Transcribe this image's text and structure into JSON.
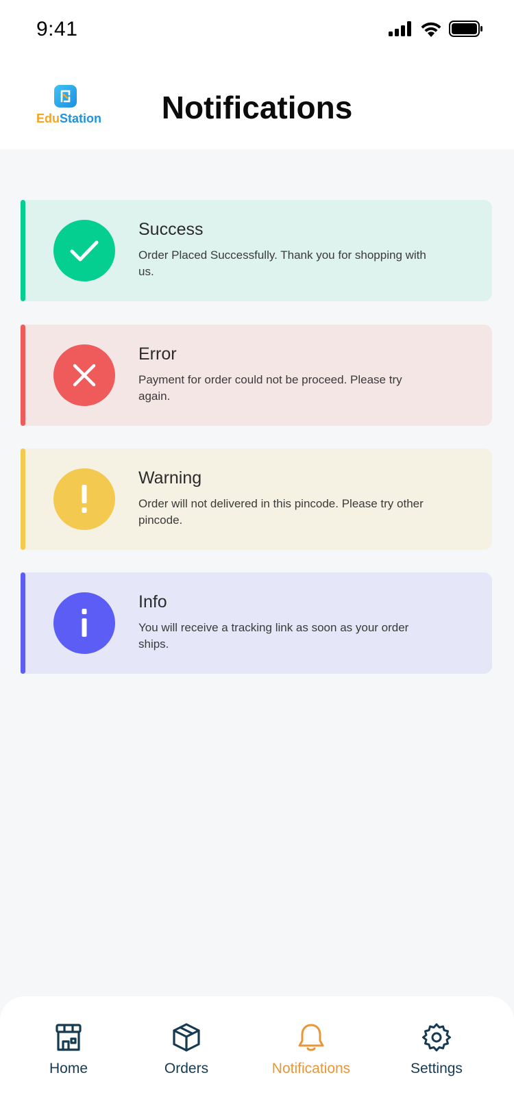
{
  "status_bar": {
    "time": "9:41",
    "icons": [
      "cellular-signal-icon",
      "wifi-icon",
      "battery-icon"
    ]
  },
  "header": {
    "logo": {
      "part1": "Edu",
      "part2": "Station"
    },
    "title": "Notifications"
  },
  "notifications": [
    {
      "type": "success",
      "icon": "checkmark-icon",
      "title": "Success",
      "message": "Order Placed Successfully. Thank you for shopping with us.",
      "accent_color": "#05CE91",
      "background_color": "#DEF2EE"
    },
    {
      "type": "error",
      "icon": "close-icon",
      "title": "Error",
      "message": "Payment for order could not be proceed. Please try again.",
      "accent_color": "#EF5A5A",
      "background_color": "#F5E6E6"
    },
    {
      "type": "warning",
      "icon": "exclamation-icon",
      "title": "Warning",
      "message": "Order will not delivered in this pincode. Please try other pincode.",
      "accent_color": "#F4C94F",
      "background_color": "#F5F1E3"
    },
    {
      "type": "info",
      "icon": "info-icon",
      "title": "Info",
      "message": "You will receive a tracking link as soon as your order ships.",
      "accent_color": "#5B5DF5",
      "background_color": "#E5E6F7"
    }
  ],
  "bottom_nav": {
    "items": [
      {
        "label": "Home",
        "icon": "store-icon",
        "active": false
      },
      {
        "label": "Orders",
        "icon": "package-icon",
        "active": false
      },
      {
        "label": "Notifications",
        "icon": "bell-icon",
        "active": true
      },
      {
        "label": "Settings",
        "icon": "gear-icon",
        "active": false
      }
    ],
    "active_color": "#E9963A",
    "inactive_color": "#163A52"
  }
}
